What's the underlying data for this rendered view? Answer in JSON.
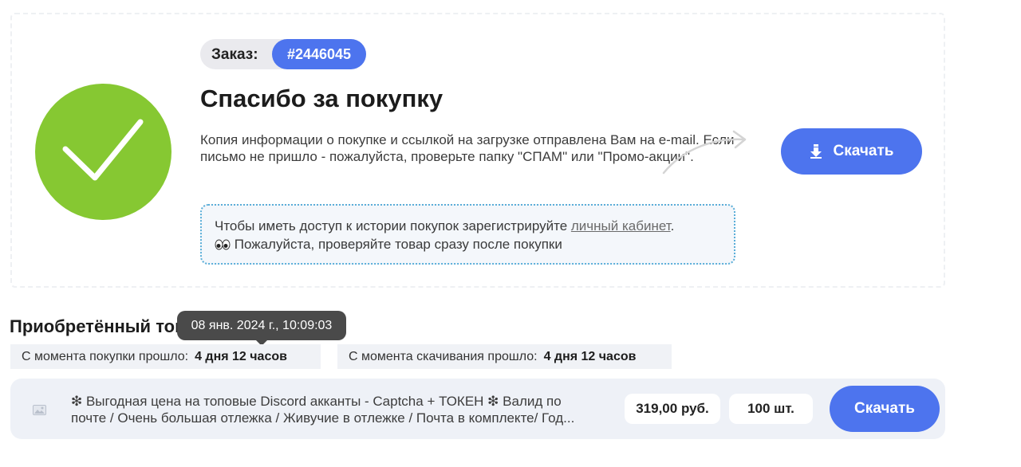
{
  "order": {
    "label": "Заказ:",
    "number": "#2446045"
  },
  "confirmation": {
    "title": "Спасибо за покупку",
    "text": "Копия информации о покупке и ссылкой на загрузке отправлена Вам на e-mail. Если письмо не пришло - пожалуйста, проверьте папку \"СПАМ\" или \"Промо-акции\".",
    "download_label": "Скачать",
    "download_icon": "download-arrow-icon"
  },
  "notice": {
    "line1_prefix": "Чтобы иметь доступ к истории покупок зарегистрируйте ",
    "line1_link": "личный кабинет",
    "line1_suffix": ".",
    "line2_emoji": "eyes-emoji",
    "line2_text": " Пожалуйста, проверяйте товар сразу после покупки"
  },
  "purchased": {
    "title": "Приобретённый товар",
    "tooltip": "08 янв. 2024 г., 10:09:03",
    "since_purchase_label": "С момента покупки прошло:",
    "since_purchase_value": "4 дня 12 часов",
    "since_download_label": "С момента скачивания прошло:",
    "since_download_value": "4 дня 12 часов"
  },
  "product": {
    "image_icon": "image-placeholder-icon",
    "description_line1": "❇ Выгодная цена на топовые Discord акканты - Captcha + ТОКЕН ❇ Валид по",
    "description_line2": "почте / Очень большая отлежка / Живучие в отлежке / Почта в комплекте/ Год...",
    "price": "319,00 руб.",
    "quantity": "100 шт.",
    "download_label": "Скачать"
  },
  "colors": {
    "accent": "#4d74ee",
    "success": "#86c832",
    "tooltip_bg": "#4a4a4a"
  }
}
